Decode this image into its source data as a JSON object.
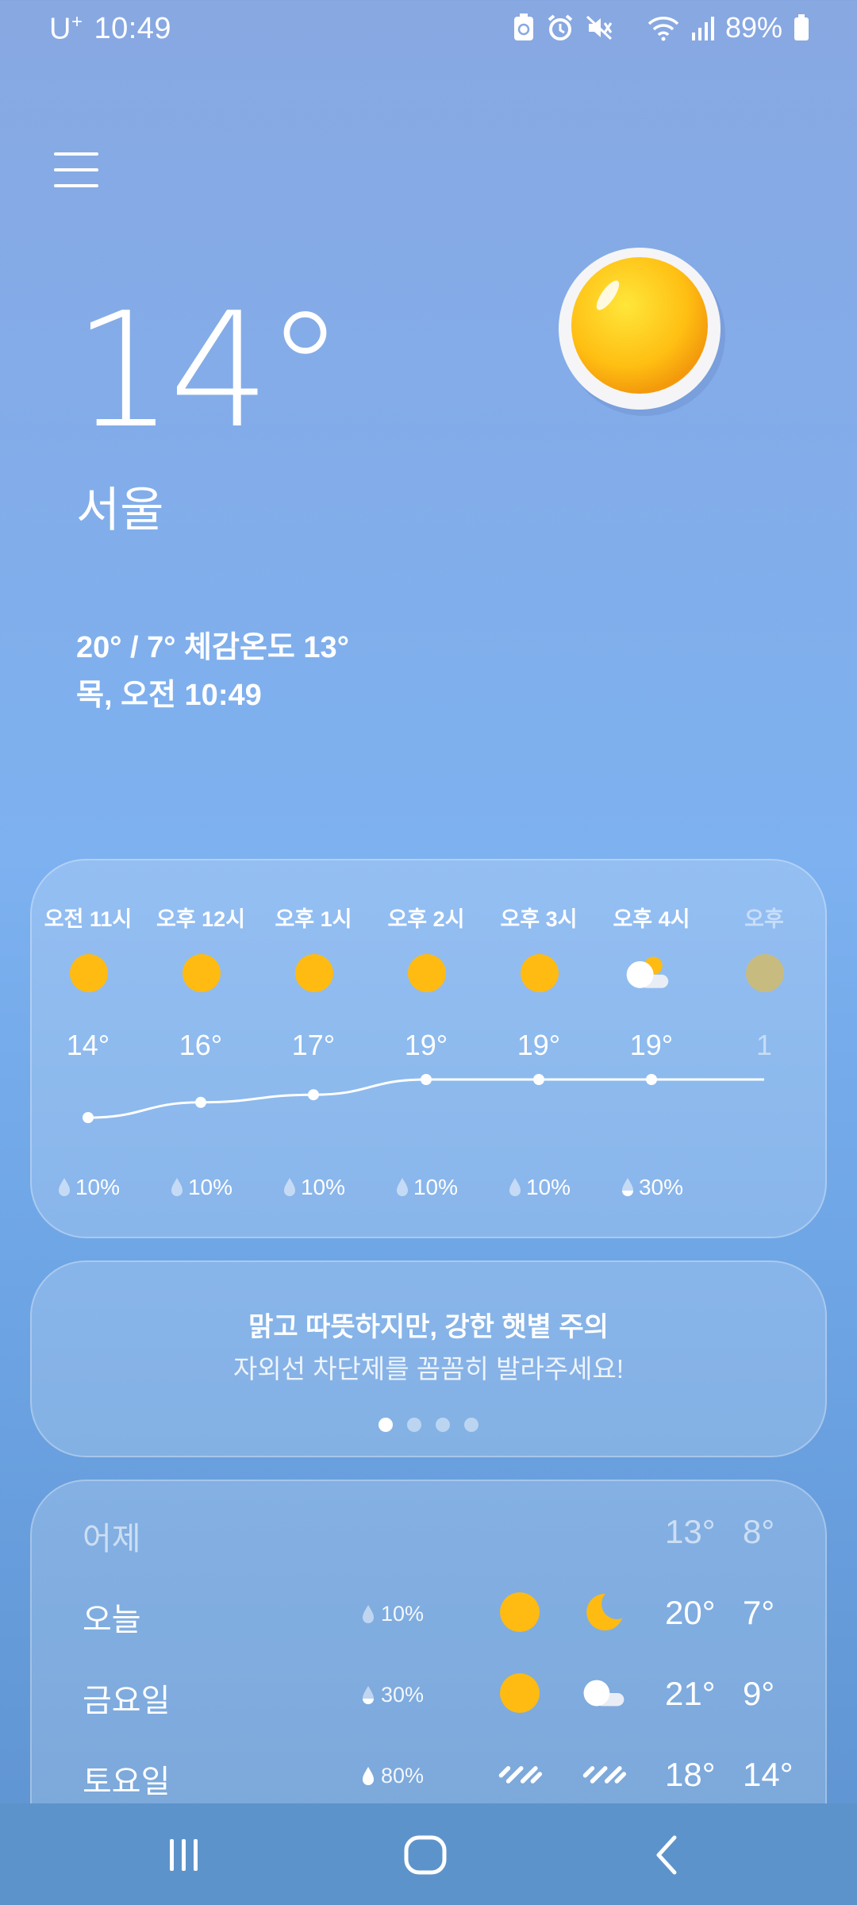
{
  "status_bar": {
    "carrier": "U",
    "carrier_sup": "+",
    "time": "10:49",
    "battery": "89%"
  },
  "current": {
    "temperature": "14°",
    "city": "서울",
    "hi_lo_feels": "20° / 7° 체감온도 13°",
    "datetime": "목, 오전 10:49"
  },
  "hourly": [
    {
      "time": "오전 11시",
      "icon": "sun-icon",
      "temp": "14°",
      "rain": "10%",
      "temp_value": 14
    },
    {
      "time": "오후 12시",
      "icon": "sun-icon",
      "temp": "16°",
      "rain": "10%",
      "temp_value": 16
    },
    {
      "time": "오후 1시",
      "icon": "sun-icon",
      "temp": "17°",
      "rain": "10%",
      "temp_value": 17
    },
    {
      "time": "오후 2시",
      "icon": "sun-icon",
      "temp": "19°",
      "rain": "10%",
      "temp_value": 19
    },
    {
      "time": "오후 3시",
      "icon": "sun-icon",
      "temp": "19°",
      "rain": "10%",
      "temp_value": 19
    },
    {
      "time": "오후 4시",
      "icon": "partly-cloudy-icon",
      "temp": "19°",
      "rain": "30%",
      "temp_value": 19
    },
    {
      "time": "오후",
      "icon": "sun-icon",
      "temp": "1",
      "rain": "",
      "temp_value": 19
    }
  ],
  "tip": {
    "title": "맑고 따뜻하지만, 강한 햇볕 주의",
    "subtitle": "자외선 차단제를 꼼꼼히 발라주세요!",
    "page_count": 4,
    "active_page": 1
  },
  "daily": [
    {
      "day": "어제",
      "rain": "",
      "am_icon": "",
      "pm_icon": "",
      "hi": "13°",
      "lo": "8°",
      "dim": true
    },
    {
      "day": "오늘",
      "rain": "10%",
      "am_icon": "sun-icon",
      "pm_icon": "moon-icon",
      "hi": "20°",
      "lo": "7°",
      "dim": false
    },
    {
      "day": "금요일",
      "rain": "30%",
      "am_icon": "sun-icon",
      "pm_icon": "cloud-icon",
      "hi": "21°",
      "lo": "9°",
      "dim": false
    },
    {
      "day": "토요일",
      "rain": "80%",
      "am_icon": "rain-icon",
      "pm_icon": "rain-icon",
      "hi": "18°",
      "lo": "14°",
      "dim": false
    }
  ],
  "colors": {
    "sun": "#ffbb12",
    "background_top": "#88a8e2",
    "background_bottom": "#5e93d0",
    "nav_bar": "#5d93cb"
  }
}
